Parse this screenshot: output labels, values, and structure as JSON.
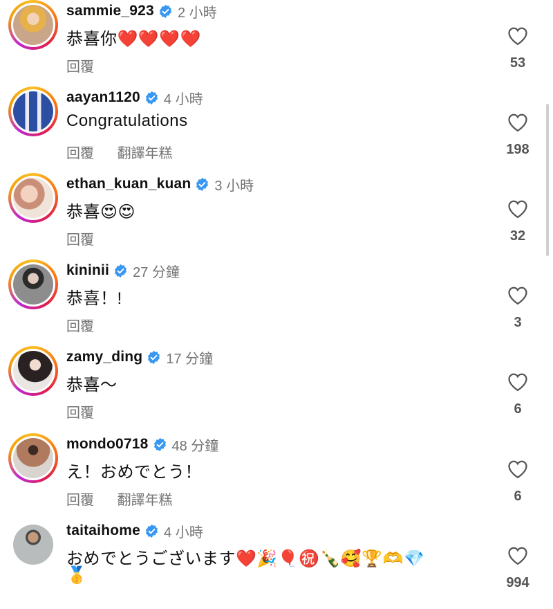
{
  "reply_label": "回覆",
  "translate_label": "翻譯年糕",
  "comments": [
    {
      "username": "sammie_923",
      "time": "2 小時",
      "text": "恭喜你❤️❤️❤️❤️",
      "likes": "53",
      "translate": false,
      "ring": true,
      "avatar_color": "#e8b04a"
    },
    {
      "username": "aayan1120",
      "time": "4 小時",
      "text": "Congratulations",
      "likes": "198",
      "translate": true,
      "ring": true,
      "avatar_color": "#3b5ba8"
    },
    {
      "username": "ethan_kuan_kuan",
      "time": "3 小時",
      "text": "恭喜😍😍",
      "likes": "32",
      "translate": false,
      "ring": true,
      "avatar_color": "#d8a38a"
    },
    {
      "username": "kininii",
      "time": "27 分鐘",
      "text": "恭喜！!",
      "likes": "3",
      "translate": false,
      "ring": true,
      "avatar_color": "#6a6a6a"
    },
    {
      "username": "zamy_ding",
      "time": "17 分鐘",
      "text": "恭喜～",
      "likes": "6",
      "translate": false,
      "ring": true,
      "avatar_color": "#3a3030"
    },
    {
      "username": "mondo0718",
      "time": "48 分鐘",
      "text": "え！おめでとう！",
      "likes": "6",
      "translate": true,
      "ring": true,
      "avatar_color": "#8a5a44"
    },
    {
      "username": "taitaihome",
      "time": "4 小時",
      "text": "おめでとうございます❤️🎉🎈㊗️🍾🥰🏆🫶💎",
      "text2": "🥇",
      "likes": "994",
      "translate": false,
      "ring": false,
      "avatar_color": "#9aa3a6"
    }
  ],
  "accent_blue": "#3897f0",
  "icons": {
    "verified": "verified-badge-icon",
    "heart": "heart-outline-icon"
  }
}
